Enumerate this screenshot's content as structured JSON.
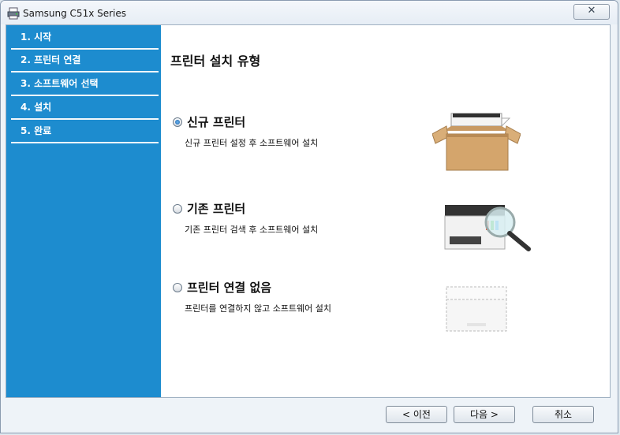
{
  "window": {
    "title": "Samsung C51x Series",
    "close_symbol": "✕"
  },
  "sidebar": {
    "steps": [
      {
        "label": "1. 시작"
      },
      {
        "label": "2. 프린터 연결"
      },
      {
        "label": "3. 소프트웨어 선택"
      },
      {
        "label": "4. 설치"
      },
      {
        "label": "5. 완료"
      }
    ]
  },
  "main": {
    "heading": "프린터 설치 유형",
    "options": [
      {
        "title": "신규 프린터",
        "description": "신규 프린터 설정 후 소프트웨어 설치",
        "selected": true,
        "icon": "printer-in-box"
      },
      {
        "title": "기존 프린터",
        "description": "기존 프린터 검색 후 소프트웨어 설치",
        "selected": false,
        "icon": "printer-magnifier"
      },
      {
        "title": "프린터 연결 없음",
        "description": "프린터를 연결하지 않고 소프트웨어 설치",
        "selected": false,
        "icon": "printer-outline"
      }
    ]
  },
  "buttons": {
    "back": "< 이전",
    "next": "다음 >",
    "cancel": "취소"
  }
}
